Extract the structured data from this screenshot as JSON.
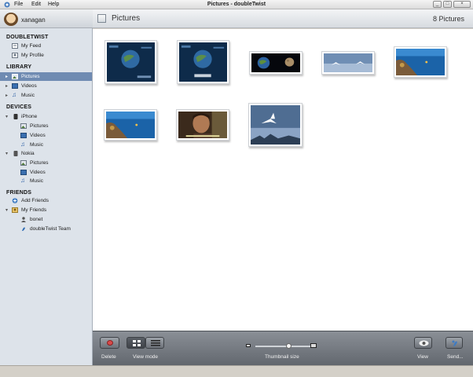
{
  "window": {
    "title": "Pictures - doubleTwist"
  },
  "menu": [
    "File",
    "Edit",
    "Help"
  ],
  "user": {
    "name": "xanagan"
  },
  "sidebar": {
    "doubletwist": {
      "heading": "DOUBLETWIST",
      "items": [
        "My Feed",
        "My Profile"
      ]
    },
    "library": {
      "heading": "LIBRARY",
      "items": [
        "Pictures",
        "Videos",
        "Music"
      ],
      "selected": "Pictures"
    },
    "devices": {
      "heading": "DEVICES",
      "iphone": {
        "label": "iPhone",
        "items": [
          "Pictures",
          "Videos",
          "Music"
        ]
      },
      "nokia": {
        "label": "Nokia",
        "items": [
          "Pictures",
          "Videos",
          "Music"
        ]
      }
    },
    "friends": {
      "heading": "FRIENDS",
      "add": "Add Friends",
      "my_friends": "My Friends",
      "items": [
        "bonet",
        "doubleTwist Team"
      ]
    }
  },
  "main": {
    "title": "Pictures",
    "count": "8 Pictures"
  },
  "thumbnails": [
    {
      "kind": "space-ui"
    },
    {
      "kind": "space-ui"
    },
    {
      "kind": "earth-moon"
    },
    {
      "kind": "birds"
    },
    {
      "kind": "reef"
    },
    {
      "kind": "reef"
    },
    {
      "kind": "man"
    },
    {
      "kind": "bird-sky"
    }
  ],
  "toolbar": {
    "delete": "Delete",
    "view_mode": "View mode",
    "thumb_size": "Thumbnail size",
    "thumb_size_value": 0.6,
    "view": "View",
    "send": "Send..."
  },
  "colors": {
    "selected_row": "#6f8bb2",
    "sidebar_bg": "#dde3ea",
    "toolbar": "#6f747b"
  }
}
